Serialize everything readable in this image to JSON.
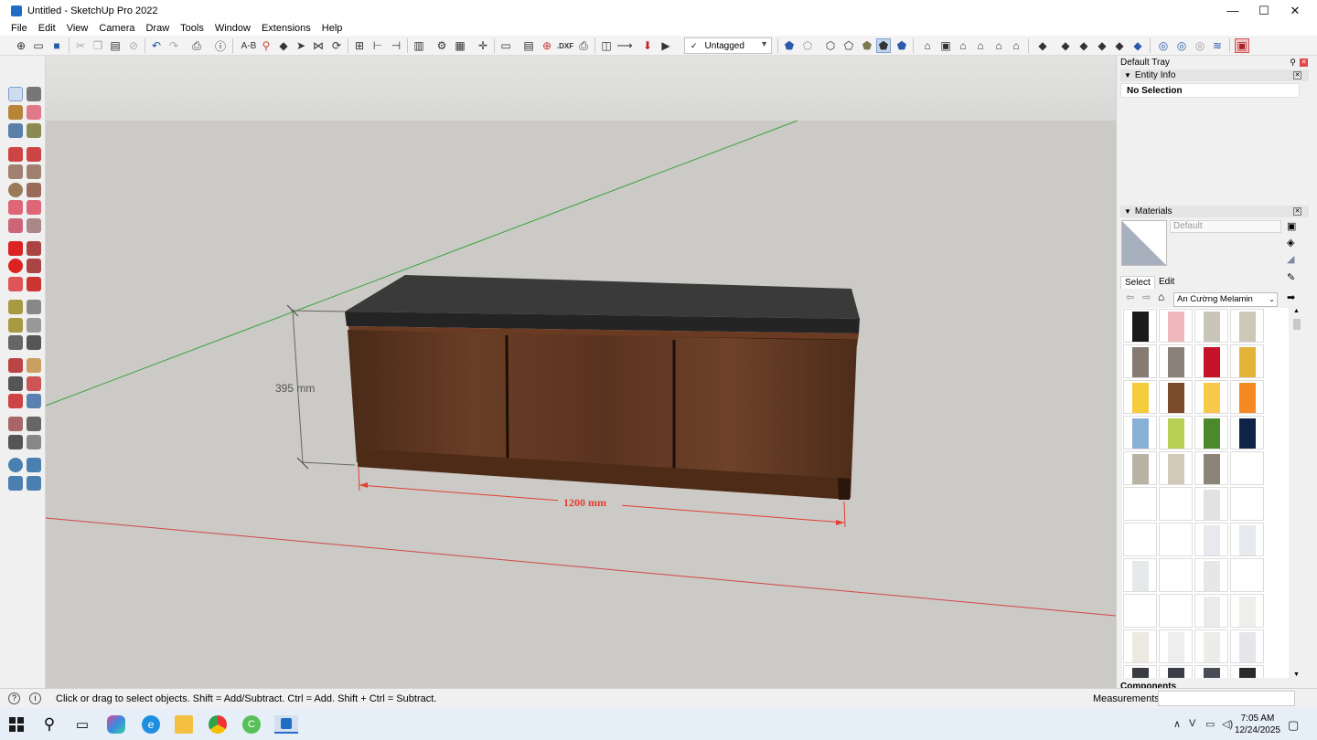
{
  "window": {
    "title": "Untitled - SketchUp Pro 2022",
    "minimize": "—",
    "maximize": "☐",
    "close": "✕"
  },
  "menu": [
    "File",
    "Edit",
    "View",
    "Camera",
    "Draw",
    "Tools",
    "Window",
    "Extensions",
    "Help"
  ],
  "toolbar": {
    "tag_value": "Untagged",
    "dxf_label": ".DXF",
    "ab_label": "A-B"
  },
  "viewport": {
    "dimension_height": "395 mm",
    "dimension_width": "1200 mm",
    "colors": {
      "background": "#cbcac6",
      "sky": "#dededc",
      "red_axis": "#d04848",
      "green_axis": "#3aa23a",
      "dimension_red": "#e04030",
      "wood": "#5a3320",
      "top": "#2e2e2e"
    }
  },
  "tray": {
    "title": "Default Tray",
    "entity_info": {
      "title": "Entity Info",
      "status": "No Selection"
    },
    "materials": {
      "title": "Materials",
      "material_name": "Default",
      "tabs": [
        "Select",
        "Edit"
      ],
      "collection": "An Cường Melamin",
      "swatches": [
        "#1a1a1a",
        "#f0b7bd",
        "#c9c5b8",
        "#cfc8b8",
        "#857b73",
        "#8b8178",
        "#c8122a",
        "#e3b33a",
        "#f5cc3c",
        "#7a4a2a",
        "#f6c94a",
        "#f48a21",
        "#8ab0d6",
        "#b7cf55",
        "#4a8a2a",
        "#0e2345",
        "#b8b3a3",
        "#d1cab8",
        "#8c8478",
        "#ffffff",
        "#ffffff",
        "#ffffff",
        "#e2e2e2",
        "#ffffff",
        "#ffffff",
        "#ffffff",
        "#e8e9ee",
        "#e6e9ee",
        "#e6e9ea",
        "#ffffff",
        "#e7e7e7",
        "#ffffff",
        "#ffffff",
        "#ffffff",
        "#ebebeb",
        "#eeeeea",
        "#eceae0",
        "#eeeeee",
        "#ecece8",
        "#e6e6ea",
        "#3a3c44",
        "#3d3f48",
        "#4a4c55",
        "#2a2a2a"
      ]
    },
    "components_title": "Components"
  },
  "statusbar": {
    "message": "Click or drag to select objects. Shift = Add/Subtract. Ctrl = Add. Shift + Ctrl = Subtract.",
    "measurements_label": "Measurements",
    "measurements_value": ""
  },
  "taskbar": {
    "time": "7:05 AM",
    "date": "12/24/2025"
  }
}
